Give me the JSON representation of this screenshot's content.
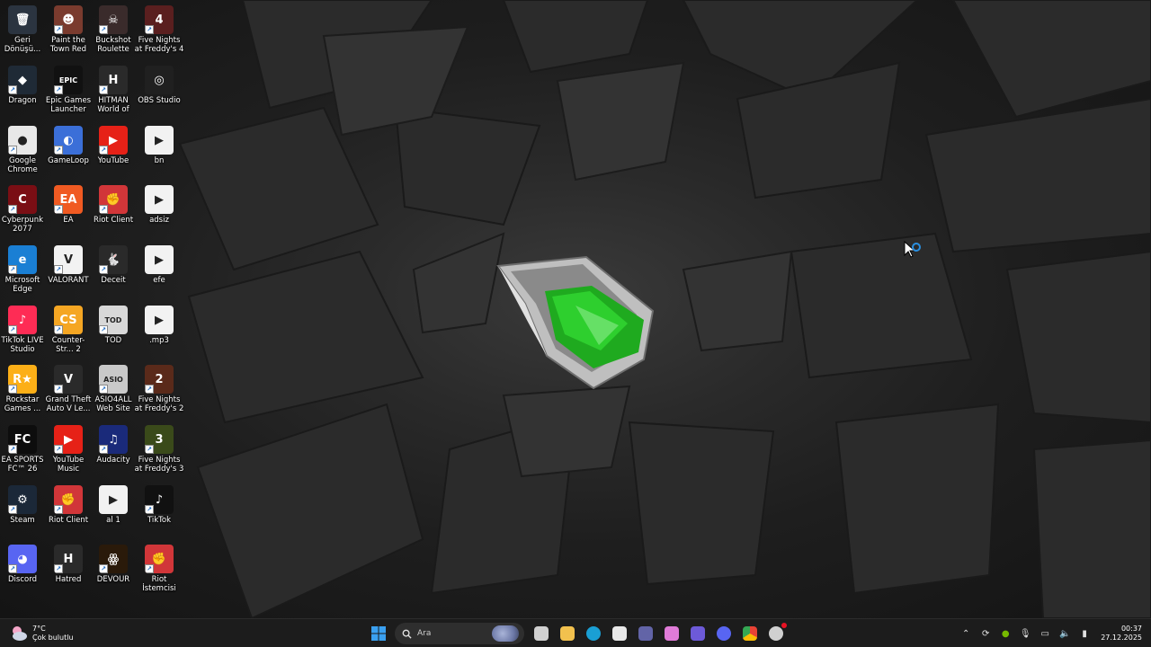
{
  "desktop": {
    "icons": [
      {
        "label": "Geri Dönüşü...",
        "icon": "recycle-bin-icon",
        "bg": "#2b3440",
        "glyph": "🗑",
        "shortcut": false
      },
      {
        "label": "Paint the Town Red",
        "icon": "paint-the-town-red-icon",
        "bg": "#7a3b2e",
        "glyph": "☻",
        "shortcut": true
      },
      {
        "label": "Buckshot Roulette",
        "icon": "buckshot-roulette-icon",
        "bg": "#3a2b2b",
        "glyph": "☠",
        "shortcut": true
      },
      {
        "label": "Five Nights at Freddy's 4",
        "icon": "fnaf4-icon",
        "bg": "#5a1f1f",
        "glyph": "4",
        "shortcut": true
      },
      {
        "label": "Dragon",
        "icon": "dragon-icon",
        "bg": "#1f2a36",
        "glyph": "◆",
        "shortcut": true
      },
      {
        "label": "Epic Games Launcher",
        "icon": "epic-games-icon",
        "bg": "#111111",
        "glyph": "EPIC",
        "shortcut": true
      },
      {
        "label": "HITMAN World of As...",
        "icon": "hitman-icon",
        "bg": "#2a2a2a",
        "glyph": "H",
        "shortcut": true
      },
      {
        "label": "OBS Studio",
        "icon": "obs-studio-icon",
        "bg": "#202020",
        "glyph": "◎",
        "shortcut": false
      },
      {
        "label": "Google Chrome",
        "icon": "chrome-icon",
        "bg": "#e8e8e8",
        "glyph": "●",
        "shortcut": true
      },
      {
        "label": "GameLoop",
        "icon": "gameloop-icon",
        "bg": "#3b6fd8",
        "glyph": "◐",
        "shortcut": true
      },
      {
        "label": "YouTube",
        "icon": "youtube-icon",
        "bg": "#e62117",
        "glyph": "▶",
        "shortcut": true
      },
      {
        "label": "bn",
        "icon": "media-file-icon",
        "bg": "#f2f2f2",
        "glyph": "▶",
        "shortcut": false
      },
      {
        "label": "Cyberpunk 2077",
        "icon": "cyberpunk-icon",
        "bg": "#7a0e14",
        "glyph": "C",
        "shortcut": true
      },
      {
        "label": "EA",
        "icon": "ea-icon",
        "bg": "#f05a22",
        "glyph": "EA",
        "shortcut": true
      },
      {
        "label": "Riot Client",
        "icon": "riot-client-icon",
        "bg": "#d13639",
        "glyph": "✊",
        "shortcut": true
      },
      {
        "label": "adsiz",
        "icon": "media-file-icon",
        "bg": "#f2f2f2",
        "glyph": "▶",
        "shortcut": false
      },
      {
        "label": "Microsoft Edge",
        "icon": "edge-icon",
        "bg": "#1a7fd4",
        "glyph": "e",
        "shortcut": true
      },
      {
        "label": "VALORANT",
        "icon": "valorant-icon",
        "bg": "#f2f2f2",
        "glyph": "V",
        "shortcut": true
      },
      {
        "label": "Deceit",
        "icon": "deceit-icon",
        "bg": "#2a2a2a",
        "glyph": "🐇",
        "shortcut": true
      },
      {
        "label": "efe",
        "icon": "media-file-icon",
        "bg": "#f2f2f2",
        "glyph": "▶",
        "shortcut": false
      },
      {
        "label": "TikTok LIVE Studio",
        "icon": "tiktok-live-studio-icon",
        "bg": "#fe2c55",
        "glyph": "♪",
        "shortcut": true
      },
      {
        "label": "Counter-Str... 2",
        "icon": "counter-strike-icon",
        "bg": "#f5a623",
        "glyph": "CS",
        "shortcut": true
      },
      {
        "label": "TOD",
        "icon": "tod-icon",
        "bg": "#d8d8d8",
        "glyph": "TOD",
        "shortcut": true
      },
      {
        "label": ".mp3",
        "icon": "media-file-icon",
        "bg": "#f2f2f2",
        "glyph": "▶",
        "shortcut": false
      },
      {
        "label": "Rockstar Games ...",
        "icon": "rockstar-icon",
        "bg": "#fcaf17",
        "glyph": "R★",
        "shortcut": true
      },
      {
        "label": "Grand Theft Auto V Le...",
        "icon": "gta-v-icon",
        "bg": "#2a2a2a",
        "glyph": "V",
        "shortcut": true
      },
      {
        "label": "ASIO4ALL Web Site",
        "icon": "asio4all-icon",
        "bg": "#c9c9c9",
        "glyph": "ASIO",
        "shortcut": true
      },
      {
        "label": "Five Nights at Freddy's 2",
        "icon": "fnaf2-icon",
        "bg": "#5a2a1a",
        "glyph": "2",
        "shortcut": true
      },
      {
        "label": "EA SPORTS FC™ 26",
        "icon": "ea-sports-fc-icon",
        "bg": "#0d0d0d",
        "glyph": "FC",
        "shortcut": true
      },
      {
        "label": "YouTube Music",
        "icon": "youtube-music-icon",
        "bg": "#e62117",
        "glyph": "▶",
        "shortcut": true
      },
      {
        "label": "Audacity",
        "icon": "audacity-icon",
        "bg": "#1a2a7a",
        "glyph": "♫",
        "shortcut": true
      },
      {
        "label": "Five Nights at Freddy's 3",
        "icon": "fnaf3-icon",
        "bg": "#3a4a1a",
        "glyph": "3",
        "shortcut": true
      },
      {
        "label": "Steam",
        "icon": "steam-icon",
        "bg": "#1b2838",
        "glyph": "⚙",
        "shortcut": true
      },
      {
        "label": "Riot Client",
        "icon": "riot-client-icon",
        "bg": "#d13639",
        "glyph": "✊",
        "shortcut": true
      },
      {
        "label": "al 1",
        "icon": "media-file-icon",
        "bg": "#f2f2f2",
        "glyph": "▶",
        "shortcut": false
      },
      {
        "label": "TikTok",
        "icon": "tiktok-icon",
        "bg": "#111111",
        "glyph": "♪",
        "shortcut": true
      },
      {
        "label": "Discord",
        "icon": "discord-icon",
        "bg": "#5865f2",
        "glyph": "◕",
        "shortcut": true
      },
      {
        "label": "Hatred",
        "icon": "hatred-icon",
        "bg": "#2a2a2a",
        "glyph": "H",
        "shortcut": true
      },
      {
        "label": "DEVOUR",
        "icon": "devour-icon",
        "bg": "#2a1a0a",
        "glyph": "ꙮ",
        "shortcut": true
      },
      {
        "label": "Riot İstemcisi",
        "icon": "riot-client-icon",
        "bg": "#d13639",
        "glyph": "✊",
        "shortcut": true
      }
    ]
  },
  "taskbar": {
    "weather": {
      "temp": "7°C",
      "condition": "Çok bulutlu",
      "icon": "cloudy-weather-icon"
    },
    "search": {
      "placeholder": "Ara"
    },
    "apps": [
      {
        "name": "start-button",
        "icon": "windows-start-icon",
        "color": "#3aa0f0"
      },
      {
        "name": "task-view-button",
        "icon": "task-view-icon",
        "color": "#d0d0d0"
      },
      {
        "name": "file-explorer-button",
        "icon": "folder-icon",
        "color": "#f2c14e"
      },
      {
        "name": "edge-taskbar-button",
        "icon": "edge-icon",
        "color": "#1a9fd4"
      },
      {
        "name": "store-taskbar-button",
        "icon": "store-icon",
        "color": "#e8e8e8"
      },
      {
        "name": "teams-taskbar-button",
        "icon": "teams-icon",
        "color": "#6264a7"
      },
      {
        "name": "copilot-taskbar-button",
        "icon": "copilot-icon",
        "color": "#e07bd8"
      },
      {
        "name": "screen-capture-taskbar-button",
        "icon": "screen-capture-icon",
        "color": "#6d5ad8"
      },
      {
        "name": "discord-taskbar-button",
        "icon": "discord-icon",
        "color": "#5865f2"
      },
      {
        "name": "chrome-taskbar-button",
        "icon": "chrome-icon",
        "color": "#f2c14e"
      },
      {
        "name": "settings-taskbar-button",
        "icon": "gear-icon",
        "color": "#d0d0d0"
      }
    ],
    "tray": [
      {
        "name": "show-hidden-icons-button",
        "icon": "chevron-up-icon"
      },
      {
        "name": "sync-tray-icon",
        "icon": "refresh-icon"
      },
      {
        "name": "nvidia-tray-icon",
        "icon": "nvidia-icon"
      },
      {
        "name": "microphone-tray-icon",
        "icon": "microphone-icon"
      },
      {
        "name": "network-tray-icon",
        "icon": "network-icon"
      },
      {
        "name": "volume-tray-icon",
        "icon": "volume-icon"
      },
      {
        "name": "battery-tray-icon",
        "icon": "battery-icon"
      }
    ],
    "clock": {
      "time": "00:37",
      "date": "27.12.2025"
    }
  }
}
